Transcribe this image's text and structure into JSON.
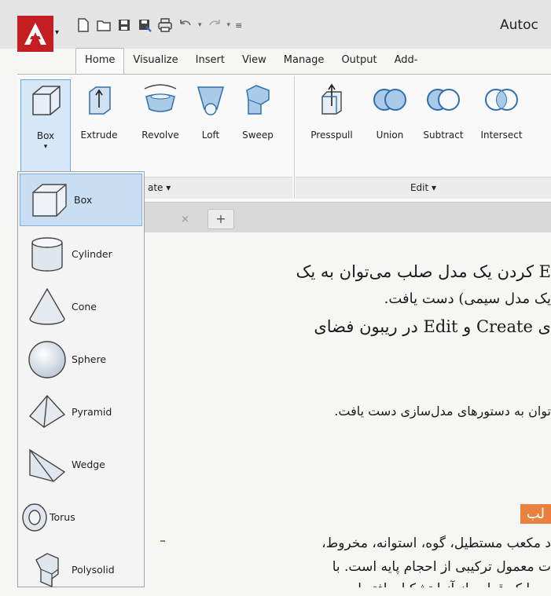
{
  "window": {
    "title": "Autoc"
  },
  "quick_access": {
    "icons": [
      "new-icon",
      "open-icon",
      "save-icon",
      "save-as-icon",
      "plot-icon",
      "undo-icon",
      "redo-icon",
      "customize-icon"
    ]
  },
  "tabs": [
    "Home",
    "Visualize",
    "Insert",
    "View",
    "Manage",
    "Output",
    "Add-"
  ],
  "ribbon": {
    "create_buttons": [
      "Box",
      "Extrude",
      "Revolve",
      "Loft",
      "Sweep"
    ],
    "edit_buttons": [
      "Presspull",
      "Union",
      "Subtract",
      "Intersect"
    ],
    "create_panel_label": "ate ▾",
    "edit_panel_label": "Edit ▾"
  },
  "dropdown": {
    "items": [
      "Box",
      "Cylinder",
      "Cone",
      "Sphere",
      "Pyramid",
      "Wedge",
      "Torus",
      "Polysolid"
    ]
  },
  "doc_tab": {
    "close": "×",
    "plus": "+"
  },
  "article": {
    "line1": "E کردن یک مدل صلب می‌توان به یک",
    "line2": "یک مدل سیمی) دست یافت.",
    "line3": "ی Create و Edit در ریبون فضای",
    "line4": "توان به دستورهای مدل‌سازی دست یافت.",
    "heading": "لب",
    "line5": "د مکعب مستطیل، گوه، استوانه، مخروط،",
    "line6": "ت معمول ترکیبی از احجام پایه است. با",
    "line7": "ی را که قطعه از آنها تشکیل یافته است،"
  },
  "colors": {
    "app_button": "#c41e22",
    "selection": "#c9def2",
    "heading_bg": "#e8813e"
  }
}
